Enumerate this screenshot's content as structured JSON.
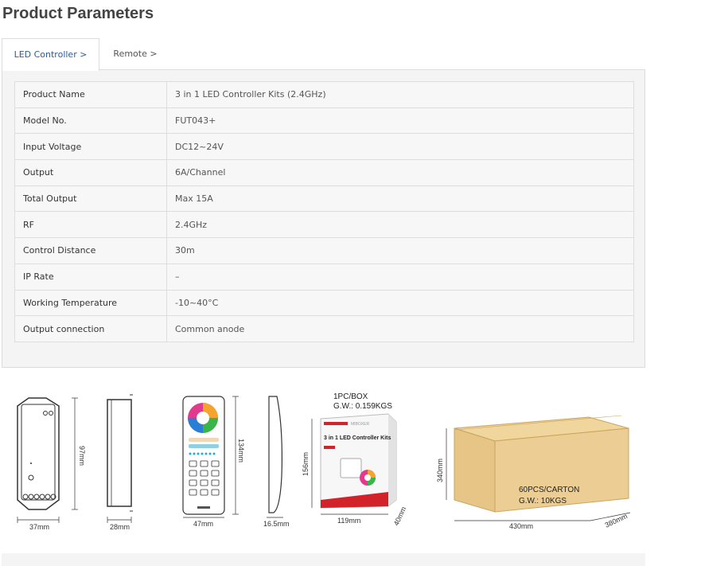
{
  "header": {
    "title": "Product Parameters"
  },
  "tabs": [
    {
      "label": "LED Controller >",
      "active": true
    },
    {
      "label": "Remote >",
      "active": false
    }
  ],
  "params": [
    {
      "key": "Product Name",
      "value": "3 in 1 LED Controller Kits (2.4GHz)"
    },
    {
      "key": "Model No.",
      "value": "FUT043+"
    },
    {
      "key": "Input Voltage",
      "value": "DC12~24V"
    },
    {
      "key": "Output",
      "value": "6A/Channel"
    },
    {
      "key": "Total Output",
      "value": "Max 15A"
    },
    {
      "key": "RF",
      "value": "2.4GHz"
    },
    {
      "key": "Control Distance",
      "value": "30m"
    },
    {
      "key": "IP Rate",
      "value": "–"
    },
    {
      "key": "Working Temperature",
      "value": "-10~40°C"
    },
    {
      "key": "Output connection",
      "value": "Common anode"
    }
  ],
  "dimensions": {
    "controller_width": "37mm",
    "controller_height": "97mm",
    "controller_depth": "28mm",
    "remote_width": "47mm",
    "remote_height": "134mm",
    "remote_depth": "16.5mm",
    "box_width": "119mm",
    "box_height": "156mm",
    "box_depth": "40mm",
    "carton_width": "430mm",
    "carton_height": "340mm",
    "carton_depth": "380mm"
  },
  "packaging": {
    "box_qty": "1PC/BOX",
    "box_weight": "G.W.: 0.159KGS",
    "box_brand": "MIBOXER",
    "box_title": "3 in 1 LED Controller Kits",
    "carton_qty": "60PCS/CARTON",
    "carton_weight": "G.W.: 10KGS"
  },
  "colors": {
    "accent": "#2a5d9c",
    "carton": "#e8c98a",
    "box_red": "#d2232a"
  }
}
